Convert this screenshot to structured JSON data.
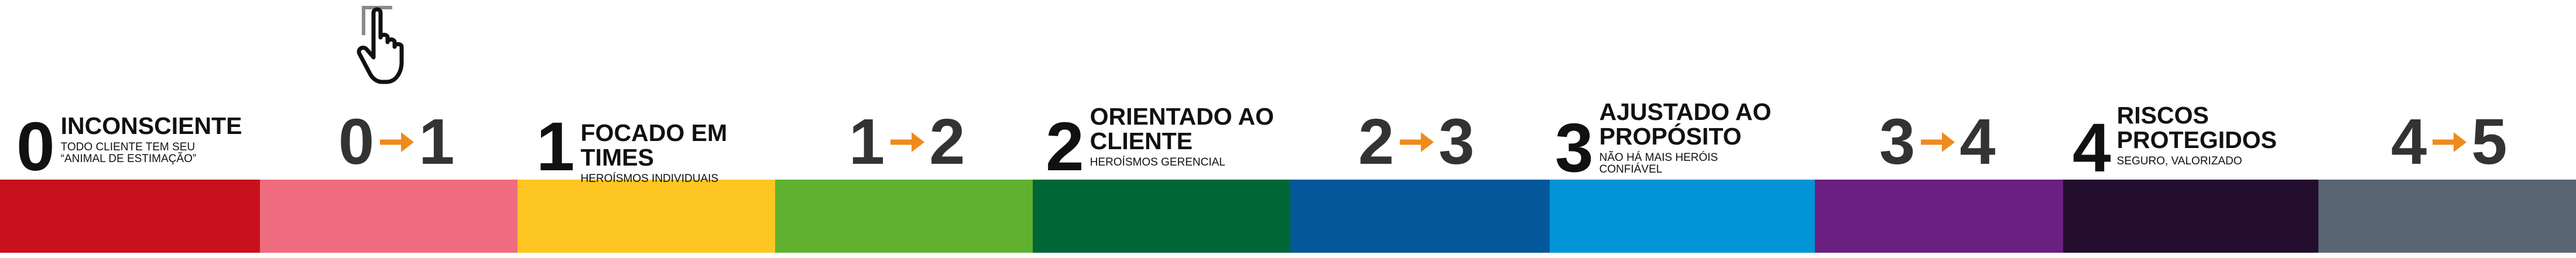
{
  "levels": [
    {
      "num": "0",
      "title": "INCONSCIENTE",
      "subtitle": "TODO CLIENTE TEM SEU “ANIMAL DE ESTIMAÇÃO”"
    },
    {
      "num": "1",
      "title": "FOCADO EM TIMES",
      "subtitle": "HEROÍSMOS INDIVIDUAIS"
    },
    {
      "num": "2",
      "title": "ORIENTADO AO CLIENTE",
      "subtitle": "HEROÍSMOS GERENCIAL"
    },
    {
      "num": "3",
      "title": "AJUSTADO AO PROPÓSITO",
      "subtitle": "NÃO HÁ MAIS HERÓIS CONFIÁVEL"
    },
    {
      "num": "4",
      "title": "RISCOS PROTEGIDOS",
      "subtitle": "SEGURO, VALORIZADO"
    }
  ],
  "transitions": [
    {
      "from": "0",
      "to": "1"
    },
    {
      "from": "1",
      "to": "2"
    },
    {
      "from": "2",
      "to": "3"
    },
    {
      "from": "3",
      "to": "4"
    },
    {
      "from": "4",
      "to": "5"
    }
  ],
  "colors": {
    "segments": [
      "#c8101d",
      "#ef6b7e",
      "#fdc623",
      "#60b12f",
      "#006836",
      "#04579b",
      "#0294d6",
      "#6a1f81",
      "#230e2f",
      "#5a6573"
    ],
    "arrow": "#ef8a1d",
    "text": "#111111",
    "transition_text": "#333333"
  },
  "icons": {
    "pointer": "hand-pointer-icon"
  }
}
